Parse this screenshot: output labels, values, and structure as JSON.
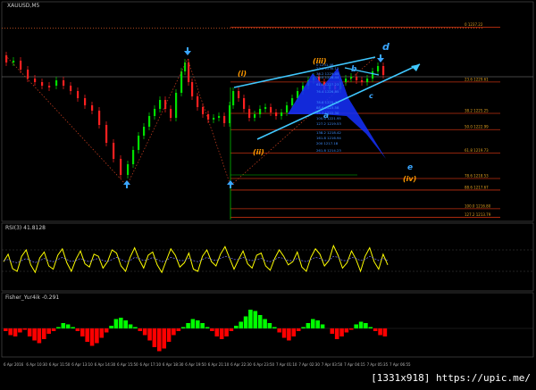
{
  "main": {
    "symbol_title": "XAUUSD,M5",
    "credit": "[1331x918] https://upic.me/"
  },
  "chart_data": [
    {
      "type": "line",
      "title": "XAUUSD,M5",
      "ylim": [
        1210.5,
        1239.5
      ],
      "price_tags": [
        {
          "label": "0 1237.22",
          "y": 1237.2,
          "color": "#e0a020"
        },
        {
          "label": "23.6 1229.61",
          "y": 1229.6,
          "color": "#e0a020"
        },
        {
          "label": "38.2 1225.25",
          "y": 1225.25,
          "color": "#e0a020"
        },
        {
          "label": "50.0 1222.99",
          "y": 1222.99,
          "color": "#e0a020"
        },
        {
          "label": "61.8 1219.73",
          "y": 1219.73,
          "color": "#e0a020"
        },
        {
          "label": "78.6 1218.53",
          "y": 1216.2,
          "color": "#e0a020"
        },
        {
          "label": "88.6 1217.67",
          "y": 1214.6,
          "color": "#e0a020"
        },
        {
          "label": "100.0 1216.80",
          "y": 1212.0,
          "color": "#e0a020"
        },
        {
          "label": "127.2 1213.79",
          "y": 1210.8,
          "color": "#e0a020"
        }
      ],
      "fib_labels": [
        {
          "label": "0 1231.46"
        },
        {
          "label": "23.6 1230.12"
        },
        {
          "label": "38.2 1229.45"
        },
        {
          "label": "50.0 1228.44"
        },
        {
          "label": "61.8 1227.23"
        },
        {
          "label": "76.4 1226.85"
        },
        {
          "label": "78.6 1225.78"
        },
        {
          "label": "88.6 1223.58"
        },
        {
          "label": "95.1 1222.30"
        },
        {
          "label": "100.0 1221.95"
        },
        {
          "label": "127.2 1219.53"
        },
        {
          "label": "138.2 1218.42"
        },
        {
          "label": "161.8 1216.94"
        },
        {
          "label": "200 1217.18"
        },
        {
          "label": "261.8 1214.23"
        }
      ],
      "wave_labels": [
        {
          "text": "d",
          "color": "#3aa6ff"
        },
        {
          "text": "(iii)",
          "color": "#ff9900"
        },
        {
          "text": "(i)",
          "color": "#ff9900"
        },
        {
          "text": "b",
          "color": "#3aa6ff"
        },
        {
          "text": "c",
          "color": "#3aa6ff"
        },
        {
          "text": "a",
          "color": "#3aa6ff"
        },
        {
          "text": "(ii)",
          "color": "#ff9900"
        },
        {
          "text": "e",
          "color": "#3aa6ff"
        },
        {
          "text": "(iv)",
          "color": "#ff9900"
        }
      ],
      "colors": {
        "up": "#00e000",
        "down": "#ff2020",
        "channel": "#40c8ff",
        "fib": "#c03010",
        "blue_fill": "#1530ff"
      }
    },
    {
      "type": "line",
      "title": "RSI(3) 41.8128",
      "ylim": [
        0,
        100
      ],
      "series": [
        {
          "color": "#ffff00",
          "values": [
            48,
            62,
            35,
            30,
            58,
            70,
            42,
            28,
            55,
            66,
            40,
            34,
            60,
            72,
            46,
            30,
            52,
            68,
            44,
            38,
            62,
            58,
            36,
            48,
            70,
            64,
            40,
            30,
            56,
            74,
            52,
            36,
            60,
            66,
            42,
            28,
            50,
            72,
            60,
            38,
            46,
            64,
            34,
            30,
            58,
            70,
            48,
            40,
            62,
            76,
            55,
            34,
            52,
            68,
            44,
            36,
            60,
            64,
            40,
            32,
            54,
            70,
            58,
            42,
            48,
            66,
            38,
            30,
            56,
            72,
            62,
            40,
            50,
            78,
            60,
            36,
            46,
            68,
            52,
            30,
            58,
            74,
            48,
            34,
            62,
            42
          ]
        },
        {
          "color": "#7777ff",
          "values": [
            50,
            52,
            48,
            46,
            50,
            54,
            50,
            46,
            50,
            54,
            50,
            48,
            52,
            56,
            52,
            48,
            50,
            54,
            50,
            48,
            52,
            54,
            50,
            48,
            52,
            56,
            52,
            48,
            50,
            56,
            54,
            50,
            52,
            56,
            52,
            48,
            50,
            56,
            54,
            50,
            50,
            54,
            50,
            48,
            52,
            56,
            52,
            50,
            54,
            58,
            56,
            52,
            52,
            56,
            52,
            50,
            52,
            54,
            50,
            48,
            52,
            56,
            54,
            50,
            50,
            54,
            50,
            48,
            52,
            56,
            54,
            50,
            50,
            58,
            56,
            50,
            50,
            56,
            54,
            50,
            52,
            58,
            54,
            50,
            54,
            50
          ]
        }
      ]
    },
    {
      "type": "bar",
      "title": "Fisher_Yur4ik -0.291",
      "ylim": [
        -1,
        1
      ],
      "values": [
        -0.1,
        -0.25,
        -0.3,
        -0.15,
        -0.05,
        -0.3,
        -0.45,
        -0.55,
        -0.4,
        -0.2,
        -0.1,
        0.05,
        0.2,
        0.15,
        0.05,
        -0.1,
        -0.3,
        -0.5,
        -0.65,
        -0.55,
        -0.35,
        -0.15,
        0.1,
        0.35,
        0.4,
        0.3,
        0.15,
        0.05,
        -0.1,
        -0.25,
        -0.45,
        -0.7,
        -0.85,
        -0.75,
        -0.5,
        -0.25,
        -0.1,
        0.05,
        0.2,
        0.35,
        0.3,
        0.2,
        0.05,
        -0.1,
        -0.3,
        -0.4,
        -0.3,
        -0.1,
        0.1,
        0.25,
        0.45,
        0.7,
        0.65,
        0.5,
        0.35,
        0.2,
        0.05,
        -0.15,
        -0.35,
        -0.45,
        -0.3,
        -0.1,
        0.05,
        0.2,
        0.35,
        0.3,
        0.15,
        0.0,
        -0.2,
        -0.4,
        -0.3,
        -0.15,
        -0.05,
        0.15,
        0.25,
        0.2,
        0.05,
        -0.1,
        -0.25,
        -0.3
      ],
      "colors": {
        "pos": "#00ff00",
        "neg": "#ff0000"
      }
    }
  ],
  "x_axis": {
    "ticks": [
      "6 Apr 2016",
      "6 Apr 10:30",
      "6 Apr 11:50",
      "6 Apr 13:10",
      "6 Apr 14:30",
      "6 Apr 15:50",
      "6 Apr 17:10",
      "6 Apr 18:30",
      "6 Apr 19:50",
      "6 Apr 21:10",
      "6 Apr 22:30",
      "6 Apr 23:50",
      "7 Apr 01:10",
      "7 Apr 02:30",
      "7 Apr 03:50",
      "7 Apr 04:15",
      "7 Apr 05:35",
      "7 Apr 06:55"
    ]
  }
}
